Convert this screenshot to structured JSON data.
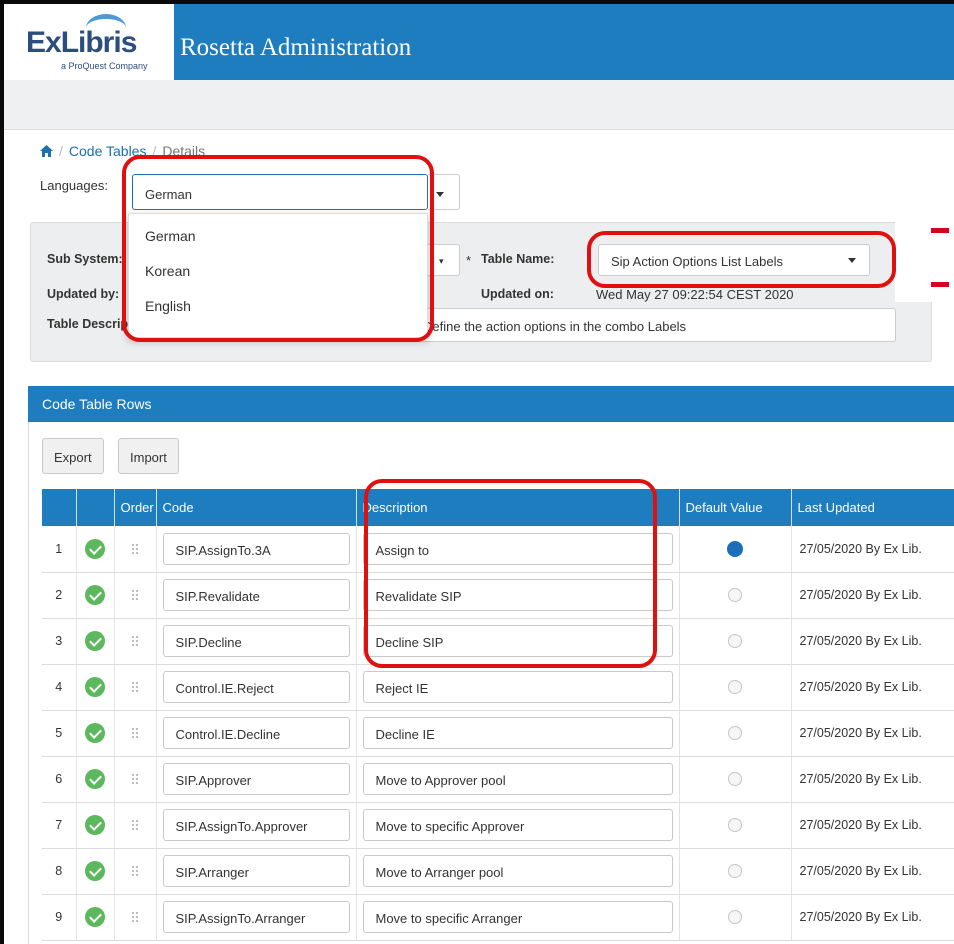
{
  "app": {
    "logo_text": "ExLibris",
    "logo_sub": "a ProQuest Company",
    "title": "Rosetta Administration"
  },
  "breadcrumb": {
    "items": [
      "Code Tables",
      "Details"
    ]
  },
  "languages": {
    "label": "Languages:",
    "selected": "German",
    "options": [
      "German",
      "Korean",
      "English"
    ]
  },
  "details": {
    "sub_system_label": "Sub System:",
    "updated_by_label": "Updated by:",
    "table_description_label": "Table Description:",
    "table_name_label": "Table Name:",
    "table_name_value": "Sip Action Options List Labels",
    "updated_on_label": "Updated on:",
    "updated_on_value": "Wed May 27 09:22:54 CEST 2020",
    "description_value": "Define the action options in the combo Labels"
  },
  "code_table_rows": {
    "title": "Code Table Rows",
    "export_label": "Export",
    "import_label": "Import",
    "columns": [
      "",
      "",
      "Order",
      "Code",
      "Description",
      "Default Value",
      "Last Updated"
    ],
    "rows": [
      {
        "num": "1",
        "code": "SIP.AssignTo.3A",
        "description": "Assign to",
        "default": true,
        "updated": "27/05/2020 By Ex Lib."
      },
      {
        "num": "2",
        "code": "SIP.Revalidate",
        "description": "Revalidate SIP",
        "default": false,
        "updated": "27/05/2020 By Ex Lib."
      },
      {
        "num": "3",
        "code": "SIP.Decline",
        "description": "Decline SIP",
        "default": false,
        "updated": "27/05/2020 By Ex Lib."
      },
      {
        "num": "4",
        "code": "Control.IE.Reject",
        "description": "Reject IE",
        "default": false,
        "updated": "27/05/2020 By Ex Lib."
      },
      {
        "num": "5",
        "code": "Control.IE.Decline",
        "description": "Decline IE",
        "default": false,
        "updated": "27/05/2020 By Ex Lib."
      },
      {
        "num": "6",
        "code": "SIP.Approver",
        "description": "Move to Approver pool",
        "default": false,
        "updated": "27/05/2020 By Ex Lib."
      },
      {
        "num": "7",
        "code": "SIP.AssignTo.Approver",
        "description": "Move to specific Approver",
        "default": false,
        "updated": "27/05/2020 By Ex Lib."
      },
      {
        "num": "8",
        "code": "SIP.Arranger",
        "description": "Move to Arranger pool",
        "default": false,
        "updated": "27/05/2020 By Ex Lib."
      },
      {
        "num": "9",
        "code": "SIP.AssignTo.Arranger",
        "description": "Move to specific Arranger",
        "default": false,
        "updated": "27/05/2020 By Ex Lib."
      }
    ]
  },
  "colors": {
    "brand_blue": "#1d7dbf",
    "highlight_red": "#e01010",
    "check_green": "#5cb85c"
  }
}
